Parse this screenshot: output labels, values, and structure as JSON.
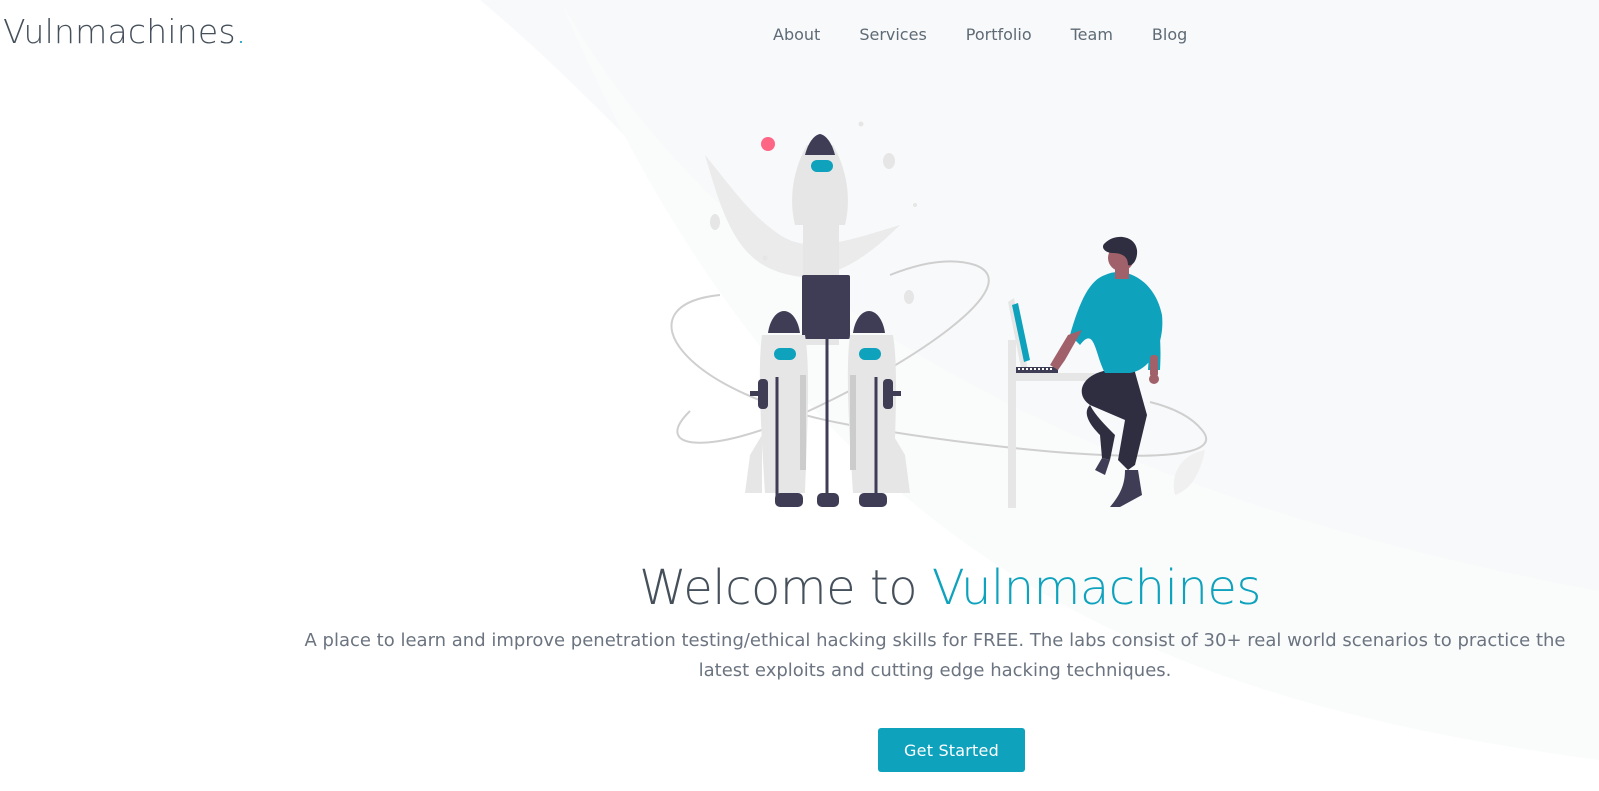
{
  "brand": {
    "name": "Vulnmachines",
    "dot": "."
  },
  "nav": {
    "items": [
      {
        "label": "About"
      },
      {
        "label": "Services"
      },
      {
        "label": "Portfolio"
      },
      {
        "label": "Team"
      },
      {
        "label": "Blog"
      }
    ]
  },
  "hero": {
    "title_prefix": "Welcome to ",
    "title_accent": "Vulnmachines",
    "subtitle": "A place to learn and improve penetration testing/ethical hacking skills for FREE. The labs consist of 30+ real world scenarios to practice the latest exploits and cutting edge hacking techniques.",
    "cta_label": "Get Started",
    "illustration": "rocket-launch-person-with-laptop-illustration"
  },
  "colors": {
    "accent": "#0ea2bd",
    "heading": "#45505b",
    "body_text": "#6b7480",
    "illustration_dark": "#3f3d56",
    "illustration_skin": "#a0616a",
    "illustration_pink": "#ff6584",
    "background_wave": "#f5f6f8"
  }
}
